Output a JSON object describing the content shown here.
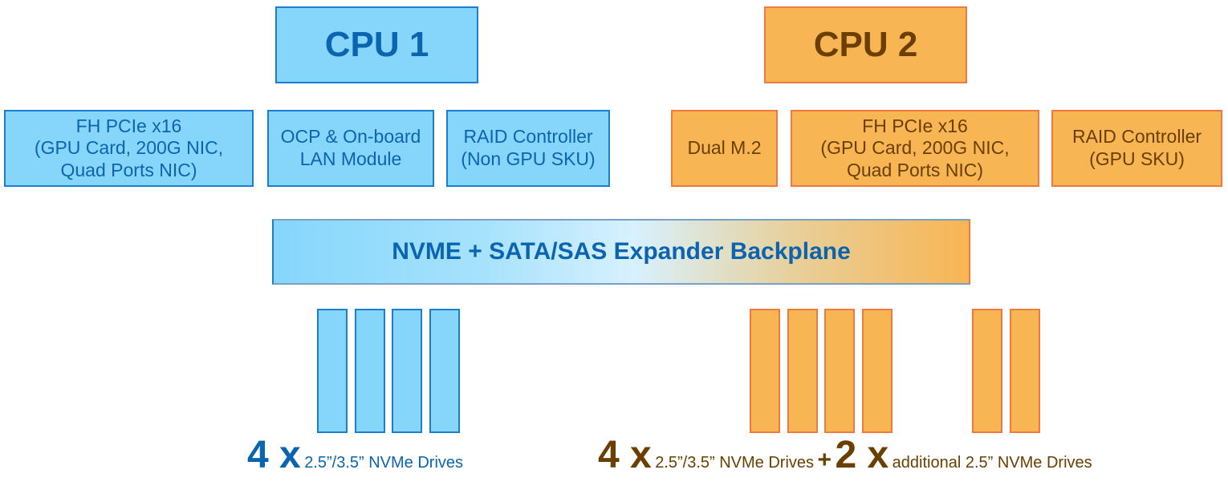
{
  "cpu1": {
    "label": "CPU 1",
    "children": [
      "FH PCIe x16\n(GPU Card, 200G NIC,\nQuad Ports NIC)",
      "OCP & On-board\nLAN Module",
      "RAID Controller\n(Non GPU SKU)"
    ]
  },
  "cpu2": {
    "label": "CPU 2",
    "children": [
      "Dual M.2",
      "FH PCIe x16\n(GPU Card, 200G NIC,\nQuad Ports NIC)",
      "RAID Controller\n(GPU SKU)"
    ]
  },
  "backplane": "NVME + SATA/SAS Expander Backplane",
  "drives": {
    "cpu1_count": 4,
    "cpu2_count": 4,
    "additional_count": 2
  },
  "captions": {
    "left_num": "4 x",
    "left_text": "2.5”/3.5” NVMe Drives",
    "right_num": "4 x",
    "right_text": "2.5”/3.5” NVMe Drives",
    "plus": "+",
    "extra_num": "2 x",
    "extra_text": "additional 2.5” NVMe Drives"
  },
  "colors": {
    "blue_fill": "#86d6fc",
    "blue_border": "#1a7fd0",
    "blue_text": "#0b64b0",
    "orange_fill": "#f8b553",
    "orange_border": "#f07a3e",
    "brown_text": "#6b3f00"
  }
}
